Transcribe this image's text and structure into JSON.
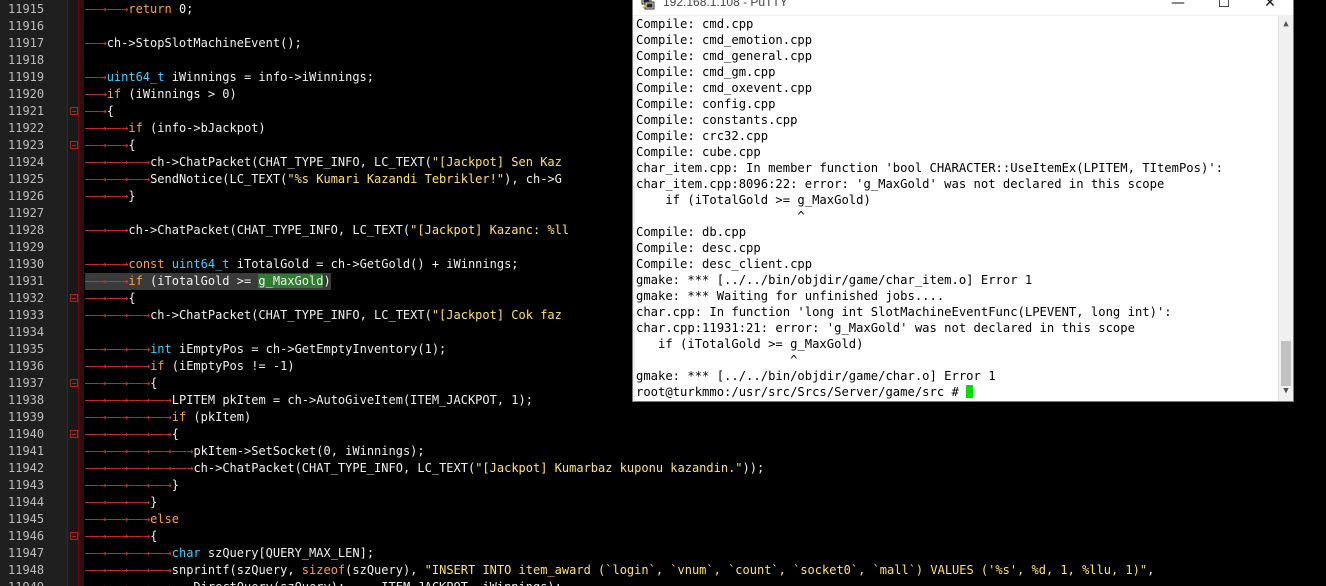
{
  "editor": {
    "lines": [
      {
        "no": "11915",
        "depth": 2,
        "tokens": [
          [
            "kw",
            "return"
          ],
          [
            "plain",
            " 0;"
          ]
        ]
      },
      {
        "no": "11916",
        "depth": 0,
        "tokens": []
      },
      {
        "no": "11917",
        "depth": 1,
        "tokens": [
          [
            "plain",
            "ch->StopSlotMachineEvent();"
          ]
        ]
      },
      {
        "no": "11918",
        "depth": 0,
        "tokens": []
      },
      {
        "no": "11919",
        "depth": 1,
        "tokens": [
          [
            "type",
            "uint64_t"
          ],
          [
            "plain",
            " iWinnings = info->iWinnings;"
          ]
        ]
      },
      {
        "no": "11920",
        "depth": 1,
        "tokens": [
          [
            "kw",
            "if"
          ],
          [
            "plain",
            " (iWinnings > 0)"
          ]
        ]
      },
      {
        "no": "11921",
        "depth": 1,
        "fold": true,
        "tokens": [
          [
            "plain",
            "{"
          ]
        ]
      },
      {
        "no": "11922",
        "depth": 2,
        "tokens": [
          [
            "kw",
            "if"
          ],
          [
            "plain",
            " (info->bJackpot)"
          ]
        ]
      },
      {
        "no": "11923",
        "depth": 2,
        "fold": true,
        "tokens": [
          [
            "plain",
            "{"
          ]
        ]
      },
      {
        "no": "11924",
        "depth": 3,
        "tokens": [
          [
            "plain",
            "ch->ChatPacket(CHAT_TYPE_INFO, LC_TEXT("
          ],
          [
            "str",
            "\"[Jackpot] Sen Kaz"
          ]
        ]
      },
      {
        "no": "11925",
        "depth": 3,
        "tokens": [
          [
            "plain",
            "SendNotice(LC_TEXT("
          ],
          [
            "str",
            "\"%s Kumari Kazandi Tebrikler!\""
          ],
          [
            "plain",
            "), ch->G"
          ]
        ]
      },
      {
        "no": "11926",
        "depth": 2,
        "tokens": [
          [
            "plain",
            "}"
          ]
        ]
      },
      {
        "no": "11927",
        "depth": 0,
        "tokens": []
      },
      {
        "no": "11928",
        "depth": 2,
        "tokens": [
          [
            "plain",
            "ch->ChatPacket(CHAT_TYPE_INFO, LC_TEXT("
          ],
          [
            "str",
            "\"[Jackpot] Kazanc: %ll"
          ]
        ]
      },
      {
        "no": "11929",
        "depth": 0,
        "tokens": []
      },
      {
        "no": "11930",
        "depth": 2,
        "tokens": [
          [
            "kw",
            "const"
          ],
          [
            "plain",
            " "
          ],
          [
            "type",
            "uint64_t"
          ],
          [
            "plain",
            " iTotalGold = ch->GetGold() + iWinnings;"
          ]
        ]
      },
      {
        "no": "11931",
        "depth": 2,
        "current": true,
        "tokens": [
          [
            "kw",
            "if"
          ],
          [
            "plain",
            " (iTotalGold >= "
          ],
          [
            "sel",
            "g_MaxGold"
          ],
          [
            "plain",
            ")"
          ]
        ]
      },
      {
        "no": "11932",
        "depth": 2,
        "fold": true,
        "tokens": [
          [
            "plain",
            "{"
          ]
        ]
      },
      {
        "no": "11933",
        "depth": 3,
        "tokens": [
          [
            "plain",
            "ch->ChatPacket(CHAT_TYPE_INFO, LC_TEXT("
          ],
          [
            "str",
            "\"[Jackpot] Cok faz"
          ]
        ]
      },
      {
        "no": "11934",
        "depth": 0,
        "tokens": []
      },
      {
        "no": "11935",
        "depth": 3,
        "tokens": [
          [
            "type",
            "int"
          ],
          [
            "plain",
            " iEmptyPos = ch->GetEmptyInventory(1);"
          ]
        ]
      },
      {
        "no": "11936",
        "depth": 3,
        "tokens": [
          [
            "kw",
            "if"
          ],
          [
            "plain",
            " (iEmptyPos != -1)"
          ]
        ]
      },
      {
        "no": "11937",
        "depth": 3,
        "fold": true,
        "tokens": [
          [
            "plain",
            "{"
          ]
        ]
      },
      {
        "no": "11938",
        "depth": 4,
        "tokens": [
          [
            "plain",
            "LPITEM pkItem = ch->AutoGiveItem(ITEM_JACKPOT, 1);"
          ]
        ]
      },
      {
        "no": "11939",
        "depth": 4,
        "tokens": [
          [
            "kw",
            "if"
          ],
          [
            "plain",
            " (pkItem)"
          ]
        ]
      },
      {
        "no": "11940",
        "depth": 4,
        "fold": true,
        "tokens": [
          [
            "plain",
            "{"
          ]
        ]
      },
      {
        "no": "11941",
        "depth": 5,
        "tokens": [
          [
            "plain",
            "pkItem->SetSocket(0, iWinnings);"
          ]
        ]
      },
      {
        "no": "11942",
        "depth": 5,
        "tokens": [
          [
            "plain",
            "ch->ChatPacket(CHAT_TYPE_INFO, LC_TEXT("
          ],
          [
            "str",
            "\"[Jackpot] Kumarbaz kuponu kazandin.\""
          ],
          [
            "plain",
            "));"
          ]
        ]
      },
      {
        "no": "11943",
        "depth": 4,
        "tokens": [
          [
            "plain",
            "}"
          ]
        ]
      },
      {
        "no": "11944",
        "depth": 3,
        "tokens": [
          [
            "plain",
            "}"
          ]
        ]
      },
      {
        "no": "11945",
        "depth": 3,
        "tokens": [
          [
            "kw",
            "else"
          ]
        ]
      },
      {
        "no": "11946",
        "depth": 3,
        "fold": true,
        "tokens": [
          [
            "plain",
            "{"
          ]
        ]
      },
      {
        "no": "11947",
        "depth": 4,
        "tokens": [
          [
            "type",
            "char"
          ],
          [
            "plain",
            " szQuery[QUERY_MAX_LEN];"
          ]
        ]
      },
      {
        "no": "11948",
        "depth": 4,
        "tokens": [
          [
            "plain",
            "snprintf(szQuery, "
          ],
          [
            "kw",
            "sizeof"
          ],
          [
            "plain",
            "(szQuery), "
          ],
          [
            "str",
            "\"INSERT INTO item_award (`login`, `vnum`, `count`, `socket0`, `mall`) VALUES ('%s', %d, 1, %llu, 1)\""
          ],
          [
            "plain",
            ","
          ]
        ]
      },
      {
        "no": "11949",
        "depth": 4,
        "tokens": [
          [
            "plain",
            "...DirectQuery(szQuery); ... ITEM_JACKPOT, iWinnings);"
          ]
        ]
      }
    ]
  },
  "putty": {
    "title": "192.168.1.108 - PuTTY",
    "buttons": {
      "minimize": "—",
      "maximize": "☐",
      "close": "✕"
    },
    "lines": [
      "Compile: cmd.cpp",
      "Compile: cmd_emotion.cpp",
      "Compile: cmd_general.cpp",
      "Compile: cmd_gm.cpp",
      "Compile: cmd_oxevent.cpp",
      "Compile: config.cpp",
      "Compile: constants.cpp",
      "Compile: crc32.cpp",
      "Compile: cube.cpp",
      "char_item.cpp: In member function 'bool CHARACTER::UseItemEx(LPITEM, TItemPos)':",
      "char_item.cpp:8096:22: error: 'g_MaxGold' was not declared in this scope",
      "    if (iTotalGold >= g_MaxGold)",
      "                      ^",
      "Compile: db.cpp",
      "Compile: desc.cpp",
      "Compile: desc_client.cpp",
      "gmake: *** [../../bin/objdir/game/char_item.o] Error 1",
      "gmake: *** Waiting for unfinished jobs....",
      "char.cpp: In function 'long int SlotMachineEventFunc(LPEVENT, long int)':",
      "char.cpp:11931:21: error: 'g_MaxGold' was not declared in this scope",
      "   if (iTotalGold >= g_MaxGold)",
      "                     ^",
      "gmake: *** [../../bin/objdir/game/char.o] Error 1",
      "root@turkmmo:/usr/src/Srcs/Server/game/src # "
    ],
    "colors": {
      "cursor": "#00e000"
    }
  }
}
